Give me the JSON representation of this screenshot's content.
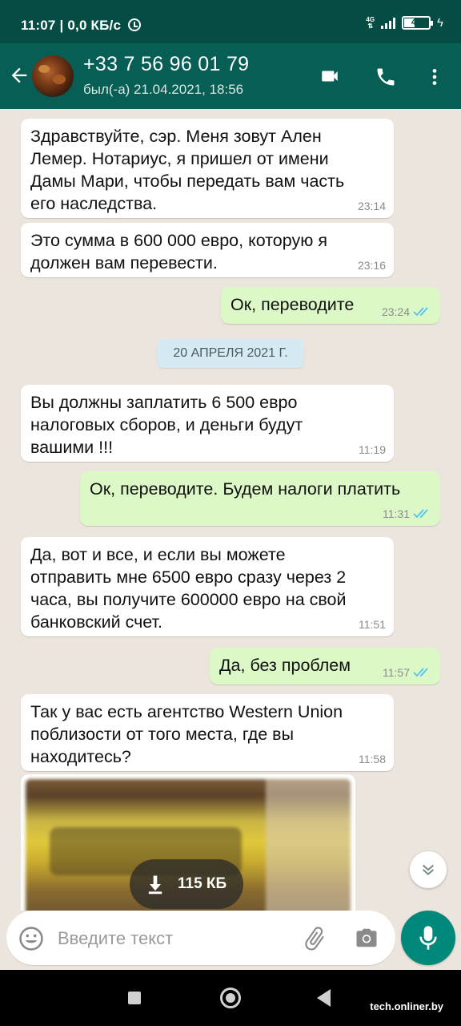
{
  "status_bar": {
    "time": "11:07",
    "speed": "0,0 КБ/с",
    "network": "4G",
    "battery": "42",
    "battery_level": 0.42
  },
  "header": {
    "contact_name": "+33 7 56 96 01 79",
    "last_seen": "был(-а) 21.04.2021, 18:56"
  },
  "messages": [
    {
      "dir": "in",
      "text": "Здравствуйте, сэр. Меня зовут Ален\nЛемер. Нотариус, я пришел от имени\nДамы Мари, чтобы передать вам часть\nего наследства.",
      "time": "23:14"
    },
    {
      "dir": "in",
      "text": "Это сумма в 600 000 евро, которую я\nдолжен вам перевести.",
      "time": "23:16"
    },
    {
      "dir": "out",
      "text": "Ок, переводите",
      "time": "23:24",
      "read": true
    },
    {
      "dir": "in",
      "text": "Вы должны заплатить 6 500 евро\nналоговых сборов, и деньги будут\nвашими !!!",
      "time": "11:19"
    },
    {
      "dir": "out",
      "text": "Ок, переводите. Будем налоги платить",
      "time": "11:31",
      "read": true
    },
    {
      "dir": "in",
      "text": "Да, вот и все, и если вы можете\nотправить мне 6500 евро сразу через 2\nчаса, вы получите 600000 евро на свой\nбанковский счет.",
      "time": "11:51"
    },
    {
      "dir": "out",
      "text": "Да, без проблем",
      "time": "11:57",
      "read": true
    },
    {
      "dir": "in",
      "text": "Так у вас есть агентство Western Union\nпоблизости от того места, где вы\nнаходитесь?",
      "time": "11:58"
    }
  ],
  "date_chip": "20 АПРЕЛЯ 2021 Г.",
  "media": {
    "download_size": "115 КБ"
  },
  "composer": {
    "placeholder": "Введите текст"
  },
  "watermark": "tech.onliner.by",
  "colors": {
    "header": "#075e54",
    "status_bar": "#054d44",
    "outgoing_bubble": "#dcf8c6",
    "incoming_bubble": "#ffffff",
    "chat_background": "#ece5dd",
    "read_ticks": "#4fc3f7",
    "mic_button": "#00897b"
  },
  "icons": {
    "back": "arrow-left-icon",
    "video": "video-call-icon",
    "phone": "phone-call-icon",
    "menu": "more-vertical-icon",
    "emoji": "emoji-icon",
    "attach": "paperclip-icon",
    "camera": "camera-icon",
    "mic": "microphone-icon",
    "download": "download-arrow-icon",
    "scroll": "double-chevron-down-icon"
  }
}
